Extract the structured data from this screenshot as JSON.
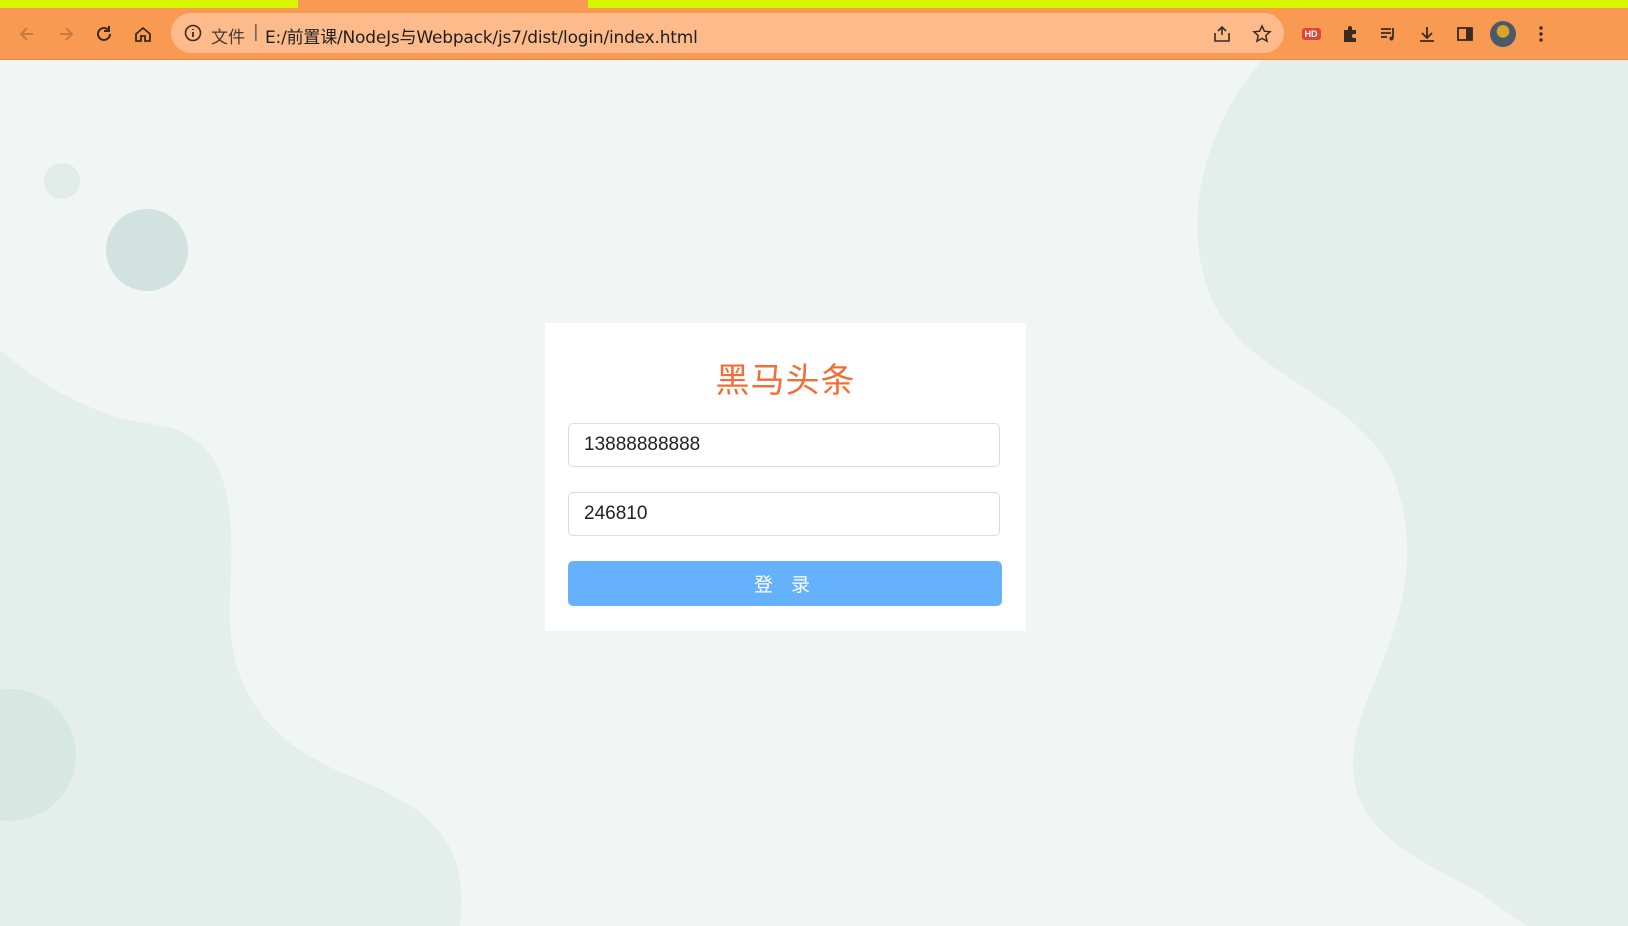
{
  "browser": {
    "omnibox": {
      "scheme_label": "文件",
      "separator": "|",
      "url": "E:/前置课/NodeJs与Webpack/js7/dist/login/index.html"
    },
    "extensions": {
      "hd_label": "HD"
    },
    "icons": [
      "back-icon",
      "forward-icon",
      "reload-icon",
      "home-icon",
      "info-icon",
      "share-icon",
      "star-icon",
      "extension-puzzle-icon",
      "media-queue-icon",
      "download-icon",
      "side-panel-icon",
      "more-icon"
    ]
  },
  "login": {
    "title": "黑马头条",
    "phone_value": "13888888888",
    "code_value": "246810",
    "submit_label": "登 录"
  },
  "colors": {
    "toolbar": "#f99a52",
    "omnibox": "#fdbb8b",
    "title": "#f36e36",
    "button": "#66b1fd",
    "page_bg": "#f1f6f4"
  }
}
